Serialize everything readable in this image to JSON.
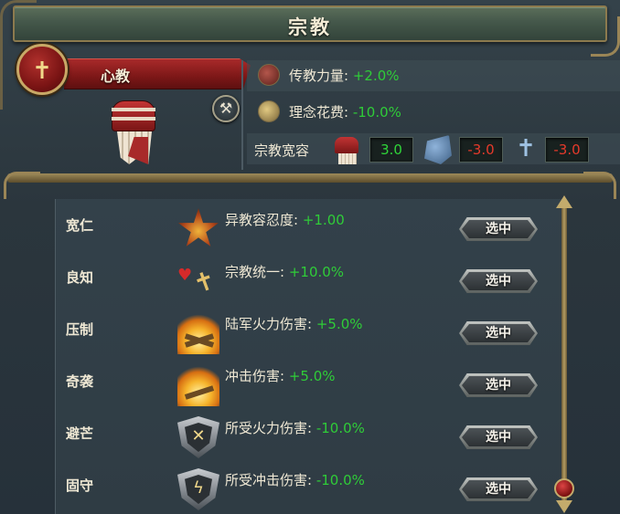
{
  "window": {
    "title": "宗教"
  },
  "religion": {
    "name": "心教",
    "emblem_glyph": "✝",
    "emblem_icon": "cross-emblem",
    "toggle_glyph": "⚒"
  },
  "stats": {
    "missionary_label": "传教力量:",
    "missionary_value": "+2.0%",
    "idea_cost_label": "理念花费:",
    "idea_cost_value": "-10.0%",
    "tolerance_label": "宗教宽容",
    "tolerance_true": "3.0",
    "tolerance_heretic": "-3.0",
    "tolerance_heathen": "-3.0"
  },
  "aspects": [
    {
      "name": "宽仁",
      "icon": "burning-star-icon",
      "effect_label": "异教容忍度:",
      "effect_value": "+1.00",
      "button": "选中"
    },
    {
      "name": "良知",
      "icon": "heart-cross-icon",
      "effect_label": "宗教统一:",
      "effect_value": "+10.0%",
      "button": "选中"
    },
    {
      "name": "压制",
      "icon": "cannon-fire-icon",
      "effect_label": "陆军火力伤害:",
      "effect_value": "+5.0%",
      "button": "选中"
    },
    {
      "name": "奇袭",
      "icon": "shock-fire-icon",
      "effect_label": "冲击伤害:",
      "effect_value": "+5.0%",
      "button": "选中"
    },
    {
      "name": "避芒",
      "icon": "fire-shield-icon",
      "effect_label": "所受火力伤害:",
      "effect_value": "-10.0%",
      "button": "选中"
    },
    {
      "name": "固守",
      "icon": "shock-shield-icon",
      "effect_label": "所受冲击伤害:",
      "effect_value": "-10.0%",
      "button": "选中"
    }
  ],
  "colors": {
    "positive": "#2fcc38",
    "negative_box": "#e53a2b",
    "banner": "#a82a2a",
    "gold_trim": "#9d8a59"
  }
}
